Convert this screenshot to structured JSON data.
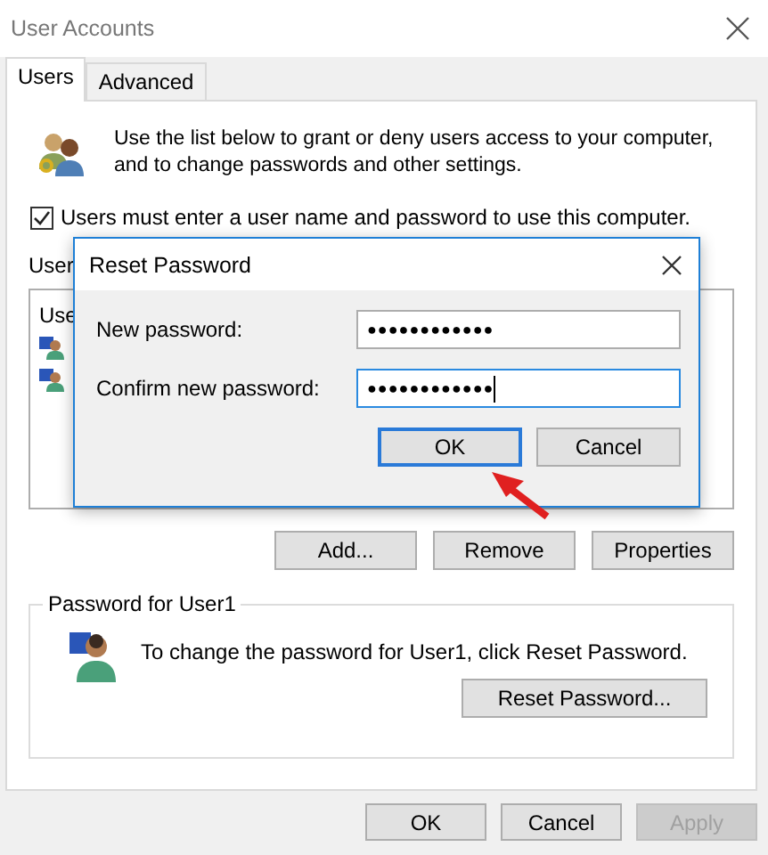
{
  "window": {
    "title": "User Accounts"
  },
  "tabs": [
    {
      "label": "Users",
      "selected": true
    },
    {
      "label": "Advanced",
      "selected": false
    }
  ],
  "intro": "Use the list below to grant or deny users access to your computer, and to change passwords and other settings.",
  "require_login": {
    "label": "Users must enter a user name and password to use this computer.",
    "checked": true
  },
  "users_label": "User",
  "users_list": {
    "column_1": "Use"
  },
  "list_buttons": [
    "Add...",
    "Remove",
    "Properties"
  ],
  "password_group": {
    "title": "Password for User1",
    "text": "To change the password for User1, click Reset Password.",
    "button": "Reset Password..."
  },
  "footer_buttons": [
    {
      "label": "OK",
      "disabled": false
    },
    {
      "label": "Cancel",
      "disabled": false
    },
    {
      "label": "Apply",
      "disabled": true
    }
  ],
  "dialog": {
    "title": "Reset Password",
    "fields": [
      {
        "label": "New password:",
        "value": "●●●●●●●●●●●●",
        "focused": false
      },
      {
        "label": "Confirm new password:",
        "value": "●●●●●●●●●●●●",
        "focused": true
      }
    ],
    "buttons": [
      {
        "label": "OK",
        "default": true
      },
      {
        "label": "Cancel",
        "default": false
      }
    ]
  }
}
